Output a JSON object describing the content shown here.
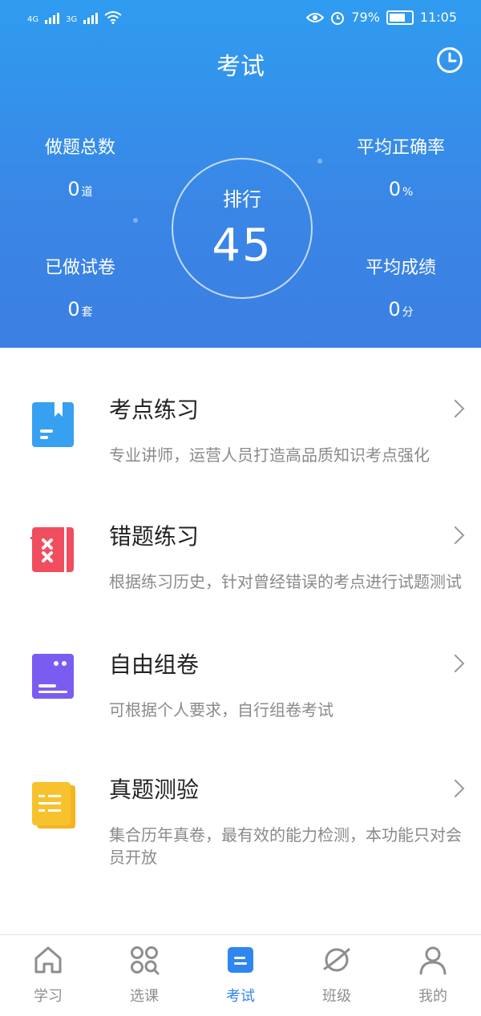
{
  "status_bar": {
    "network1": "4G",
    "network2": "3G",
    "battery_text": "79%",
    "time": "11:05"
  },
  "header": {
    "title": "考试",
    "history_icon": "clock-icon"
  },
  "stats": {
    "total_questions": {
      "label": "做题总数",
      "value": "0",
      "unit": "道"
    },
    "accuracy": {
      "label": "平均正确率",
      "value": "0",
      "unit": "%"
    },
    "papers_done": {
      "label": "已做试卷",
      "value": "0",
      "unit": "套"
    },
    "average_score": {
      "label": "平均成绩",
      "value": "0",
      "unit": "分"
    },
    "rank": {
      "label": "排行",
      "value": "45"
    }
  },
  "menu": [
    {
      "name": "考点练习",
      "desc": "专业讲师，运营人员打造高品质知识考点强化",
      "icon": "bookmark-book-icon",
      "color": "#38a0f0"
    },
    {
      "name": "错题练习",
      "desc": "根据练习历史，针对曾经错误的考点进行试题测试",
      "icon": "error-notebook-icon",
      "color": "#f04e5e"
    },
    {
      "name": "自由组卷",
      "desc": "可根据个人要求，自行组卷考试",
      "icon": "compose-paper-icon",
      "color": "#7b5cf0"
    },
    {
      "name": "真题测验",
      "desc": "集合历年真卷，最有效的能力检测，本功能只对会员开放",
      "icon": "exam-paper-icon",
      "color": "#f7c22e"
    }
  ],
  "nav": [
    {
      "label": "学习",
      "icon": "home-icon"
    },
    {
      "label": "选课",
      "icon": "grid-search-icon"
    },
    {
      "label": "考试",
      "icon": "exam-icon",
      "active": true
    },
    {
      "label": "班级",
      "icon": "planet-icon"
    },
    {
      "label": "我的",
      "icon": "user-icon"
    }
  ],
  "colors": {
    "accent": "#2f86f0",
    "header_top": "#2f9cf0",
    "header_bottom": "#3b7fe2"
  }
}
